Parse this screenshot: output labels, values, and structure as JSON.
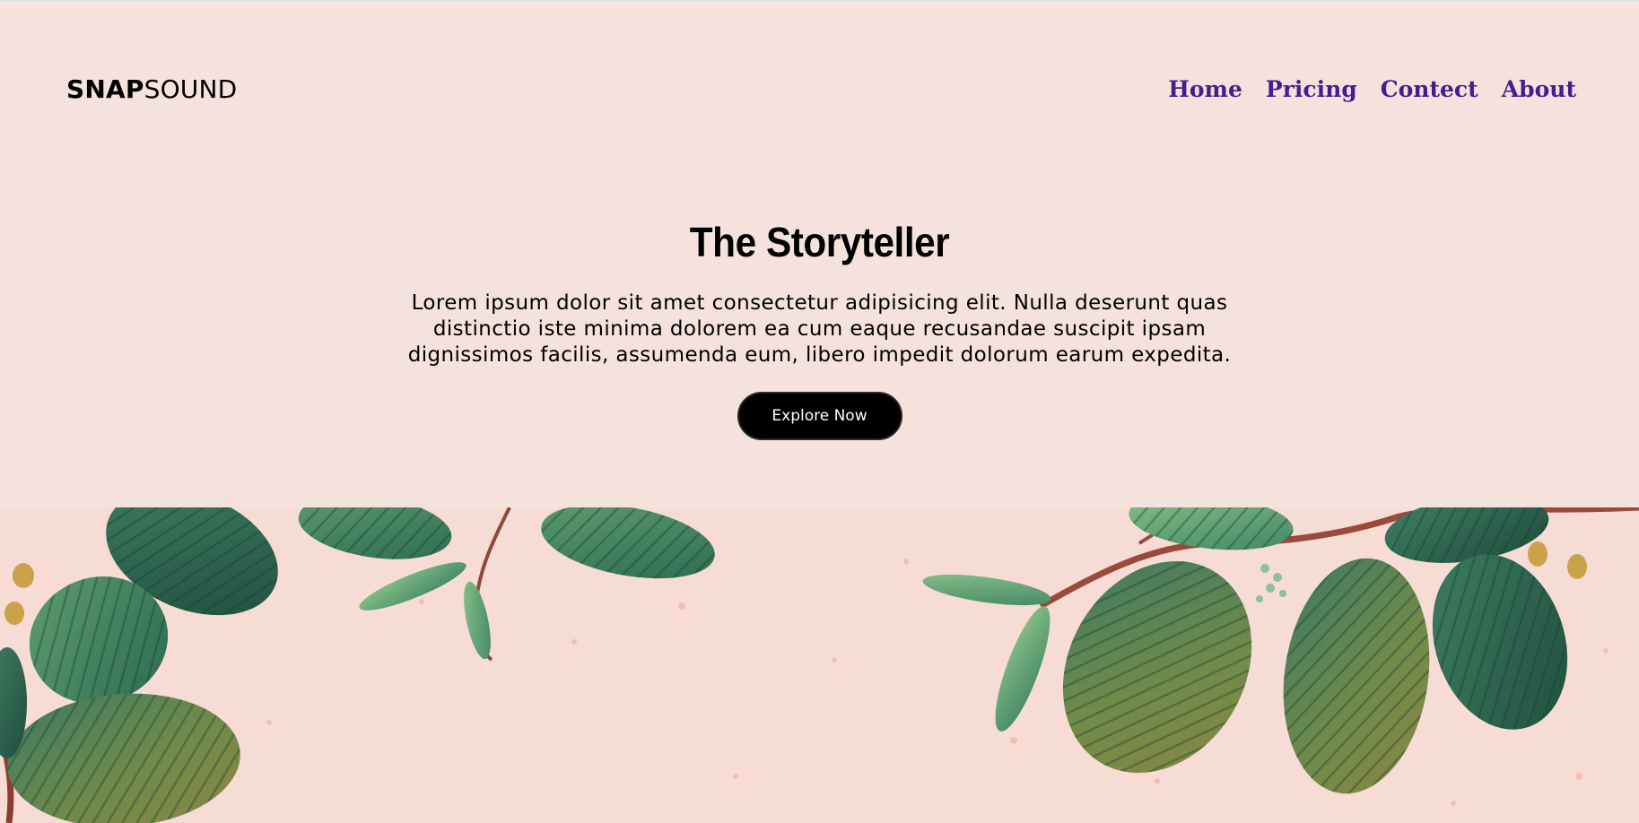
{
  "header": {
    "logo_bold": "SNAP",
    "logo_light": "SOUND",
    "nav": [
      {
        "label": "Home"
      },
      {
        "label": "Pricing"
      },
      {
        "label": "Contect"
      },
      {
        "label": "About"
      }
    ]
  },
  "hero": {
    "title": "The Storyteller",
    "description": "Lorem ipsum dolor sit amet consectetur adipisicing elit. Nulla deserunt quas distinctio iste minima dolorem ea cum eaque recusandae suscipit ipsam dignissimos facilis, assumenda eum, libero impedit dolorum earum expedita.",
    "cta_label": "Explore Now"
  },
  "banner": {
    "image": "botanical-leaves-illustration"
  },
  "colors": {
    "background": "#f5e2dc",
    "nav_link": "#4a1b8f",
    "button_bg": "#000000",
    "button_text": "#ffffff"
  }
}
